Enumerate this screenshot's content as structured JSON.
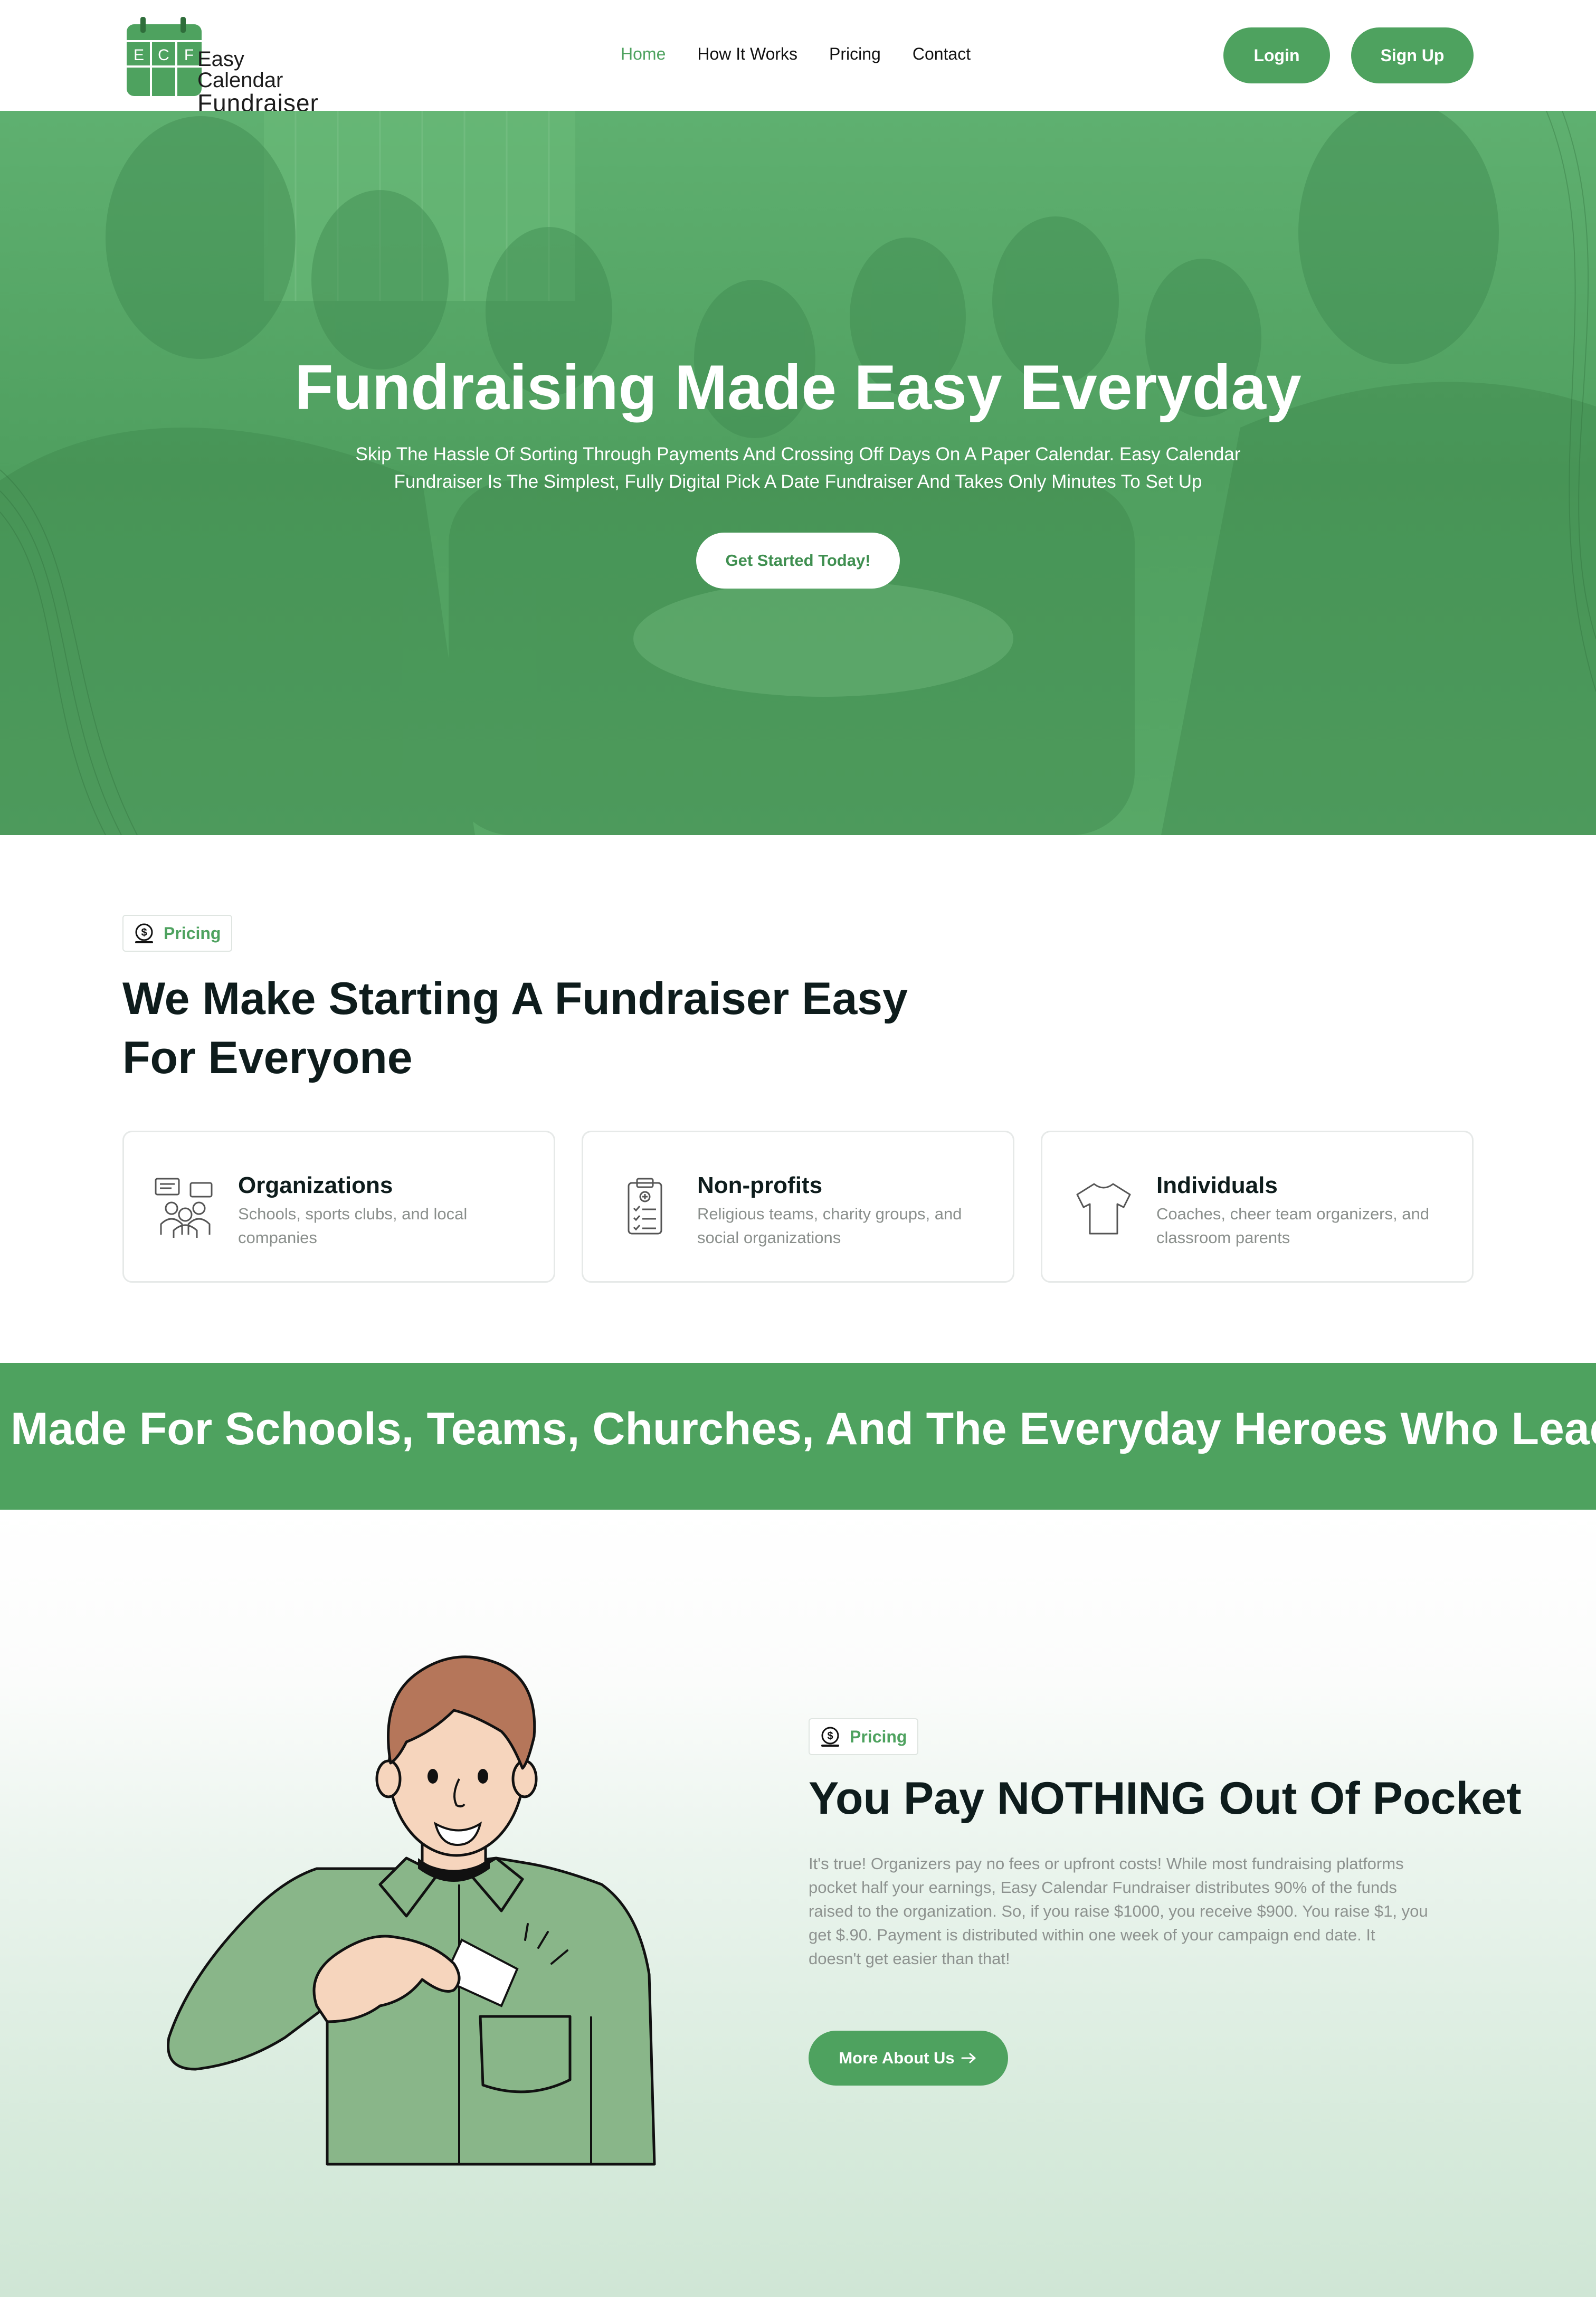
{
  "header": {
    "logo": {
      "letters": [
        "E",
        "C",
        "F"
      ],
      "line1": "Easy Calendar",
      "line2": "Fundraiser"
    },
    "nav": [
      {
        "label": "Home",
        "active": true
      },
      {
        "label": "How It Works",
        "active": false
      },
      {
        "label": "Pricing",
        "active": false
      },
      {
        "label": "Contact",
        "active": false
      }
    ],
    "login_label": "Login",
    "signup_label": "Sign Up"
  },
  "hero": {
    "title": "Fundraising Made Easy Everyday",
    "subtitle": "Skip The Hassle Of Sorting Through Payments And Crossing Off Days On A Paper Calendar. Easy Calendar Fundraiser Is The Simplest, Fully Digital Pick A Date Fundraiser And Takes Only Minutes To Set Up",
    "cta_label": "Get Started Today!"
  },
  "audience": {
    "badge": {
      "label": "Pricing",
      "icon": "money-bag-icon"
    },
    "title": "We Make Starting A Fundraiser Easy For Everyone",
    "cards": [
      {
        "title": "Organizations",
        "description": "Schools, sports clubs, and local companies",
        "icon": "group-chat-icon"
      },
      {
        "title": "Non-profits",
        "description": "Religious teams, charity groups, and social organizations",
        "icon": "clipboard-icon"
      },
      {
        "title": "Individuals",
        "description": "Coaches, cheer team organizers, and classroom parents",
        "icon": "tshirt-icon"
      }
    ]
  },
  "banner": {
    "text": "Made For Schools, Teams, Churches, And The Everyday Heroes Who Lead Them"
  },
  "pricing": {
    "badge": {
      "label": "Pricing",
      "icon": "money-bag-icon"
    },
    "title": "You Pay NOTHING Out Of Pocket",
    "description": "It's true! Organizers pay no fees or upfront costs! While most fundraising platforms pocket half your earnings, Easy Calendar Fundraiser distributes 90% of the funds raised to the organization. So, if you raise $1000, you receive $900. You raise $1, you get $.90. Payment is distributed within one week of your campaign end date. It doesn't get easier than that!",
    "button_label": "More About Us",
    "button_icon": "arrow-right-icon",
    "illustration": "man-with-money-illustration"
  },
  "colors": {
    "accent": "#4ea25f",
    "dark_text": "#0e1c1c",
    "muted_text": "#8a8f8c",
    "hero_overlay": "#56a866"
  }
}
